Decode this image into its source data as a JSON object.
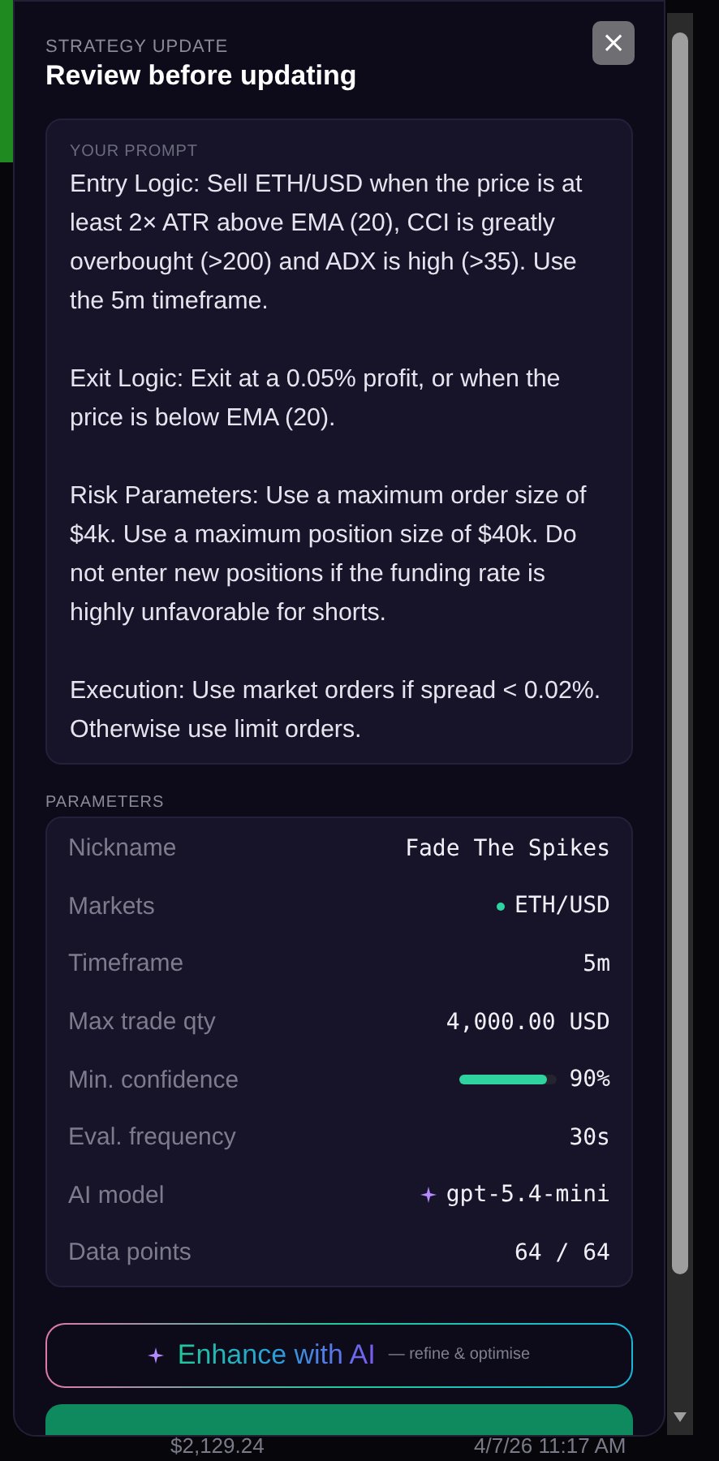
{
  "modal": {
    "eyebrow": "STRATEGY UPDATE",
    "title": "Review before updating",
    "close_label": "×"
  },
  "prompt": {
    "label": "YOUR PROMPT",
    "paragraphs": [
      "Entry Logic: Sell ETH/USD when the price is at least 2× ATR above EMA (20), CCI is greatly overbought (>200) and ADX is high (>35). Use the 5m timeframe.",
      "Exit Logic: Exit at a 0.05% profit, or when the price is below EMA (20).",
      "Risk Parameters: Use a maximum order size of $4k. Use a maximum position size of $40k. Do not enter new positions if the funding rate is highly unfavorable for shorts.",
      "Execution: Use market orders if spread < 0.02%. Otherwise use limit orders."
    ]
  },
  "parameters": {
    "label": "PARAMETERS",
    "rows": [
      {
        "kind": "text",
        "name": "Nickname",
        "value": "Fade The Spikes"
      },
      {
        "kind": "market",
        "name": "Markets",
        "value": "ETH/USD",
        "color": "#2ed3a0"
      },
      {
        "kind": "text",
        "name": "Timeframe",
        "value": "5m"
      },
      {
        "kind": "text",
        "name": "Max trade qty",
        "value": "4,000.00 USD"
      },
      {
        "kind": "meter",
        "name": "Min. confidence",
        "value": "90%",
        "level": 0.9
      },
      {
        "kind": "text",
        "name": "Eval. frequency",
        "value": "30s"
      },
      {
        "kind": "model",
        "name": "AI model",
        "value": "gpt-5.4-mini"
      },
      {
        "kind": "text",
        "name": "Data points",
        "value": "64 / 64"
      }
    ]
  },
  "enhance_button": {
    "label": "Enhance with AI",
    "hint": "— refine & optimise"
  },
  "background_row": {
    "price": "$2,129.24",
    "time": "4/7/26 11:17 AM"
  }
}
